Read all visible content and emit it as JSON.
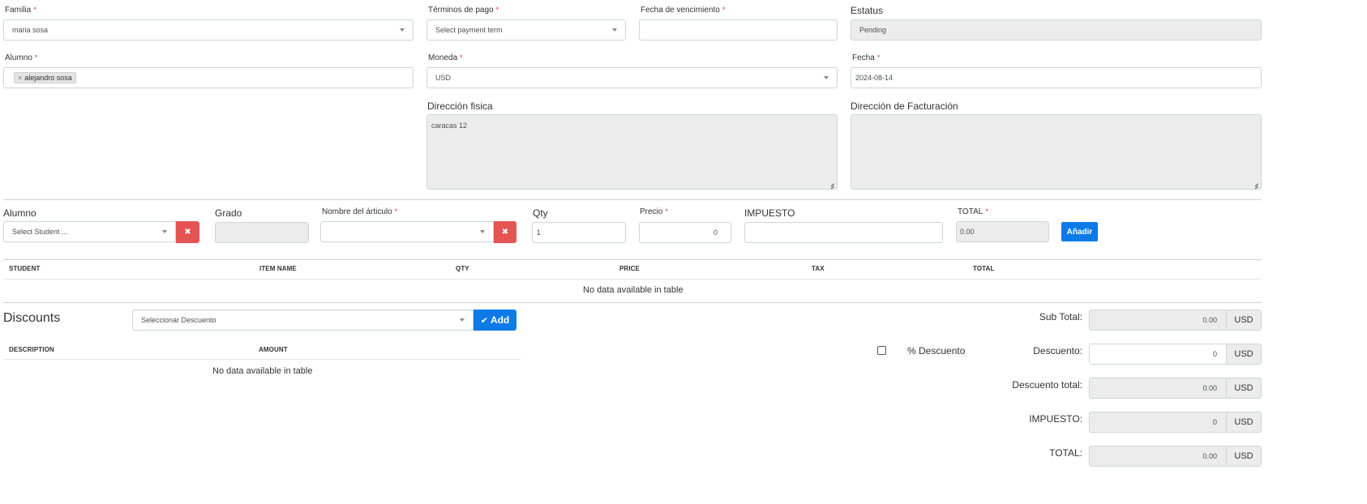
{
  "form": {
    "familia": {
      "label": "Familia",
      "value": "maria sosa"
    },
    "terminos": {
      "label": "Términos de pago",
      "placeholder": "Select payment term"
    },
    "fecha_venc": {
      "label": "Fecha de vencimiento",
      "value": ""
    },
    "estatus": {
      "label": "Estatus",
      "value": "Pending"
    },
    "alumno": {
      "label": "Alumno",
      "tag": "alejandro sosa",
      "tag_remove": "×"
    },
    "moneda": {
      "label": "Moneda",
      "value": "USD"
    },
    "fecha": {
      "label": "Fecha",
      "value": "2024-08-14"
    },
    "direccion_fisica": {
      "label": "Dirección fisica",
      "value": "caracas 12"
    },
    "direccion_facturacion": {
      "label": "Dirección de Facturación",
      "value": ""
    },
    "required_mark": "*"
  },
  "item_row": {
    "alumno": {
      "label": "Alumno",
      "placeholder": "Select Student ..."
    },
    "grado": {
      "label": "Grado",
      "value": ""
    },
    "articulo": {
      "label": "Nombre del árticulo",
      "value": ""
    },
    "qty": {
      "label": "Qty",
      "value": "1"
    },
    "precio": {
      "label": "Precio",
      "value": "0"
    },
    "impuesto": {
      "label": "IMPUESTO",
      "value": ""
    },
    "total": {
      "label": "TOTAL",
      "value": "0.00"
    },
    "clear_symbol": "✖",
    "add_label": "Añadir"
  },
  "items_table": {
    "columns": [
      "STUDENT",
      "ITEM NAME",
      "QTY",
      "PRICE",
      "TAX",
      "TOTAL"
    ],
    "empty_text": "No data available in table"
  },
  "discounts": {
    "title": "Discounts",
    "select_placeholder": "Seleccionar Descuento",
    "add_label": "Add",
    "check_symbol": "✔",
    "columns": [
      "DESCRIPTION",
      "AMOUNT"
    ],
    "empty_text": "No data available in table",
    "percent_label": "% Descuento"
  },
  "summary": {
    "currency": "USD",
    "rows": [
      {
        "label": "Sub Total:",
        "value": "0.00"
      },
      {
        "label": "Descuento:",
        "value": "0"
      },
      {
        "label": "Descuento total:",
        "value": "0.00"
      },
      {
        "label": "IMPUESTO:",
        "value": "0"
      },
      {
        "label": "TOTAL:",
        "value": "0.00"
      }
    ]
  },
  "colors": {
    "primary": "#0d7ae8",
    "danger": "#e55353",
    "readonly_bg": "#ececec",
    "required": "#dc3545"
  }
}
